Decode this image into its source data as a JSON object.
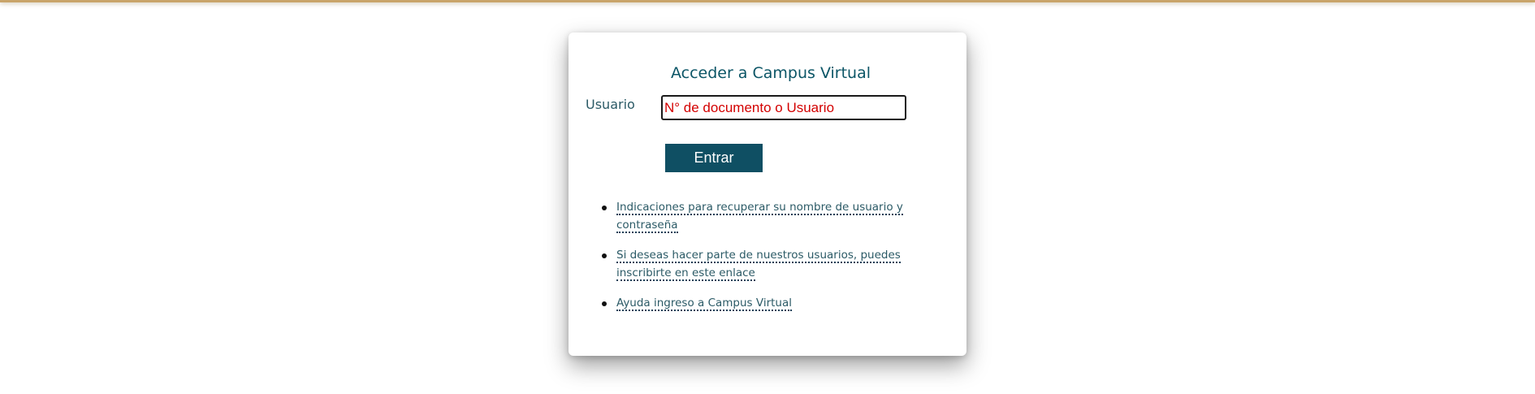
{
  "login": {
    "title": "Acceder a Campus Virtual",
    "username_label": "Usuario",
    "username_placeholder": "N° de documento o Usuario",
    "submit_label": "Entrar"
  },
  "help_links": [
    {
      "text": "Indicaciones para recuperar su nombre de usuario y contraseña"
    },
    {
      "text": "Si deseas hacer parte de nuestros usuarios, puedes inscribirte en este enlace"
    },
    {
      "text": "Ayuda ingreso a Campus Virtual"
    }
  ],
  "colors": {
    "top_bar": "#c9a46a",
    "title": "#0b5566",
    "button_bg": "#0f4f63",
    "placeholder": "#d30000",
    "link": "#2b5a66"
  }
}
